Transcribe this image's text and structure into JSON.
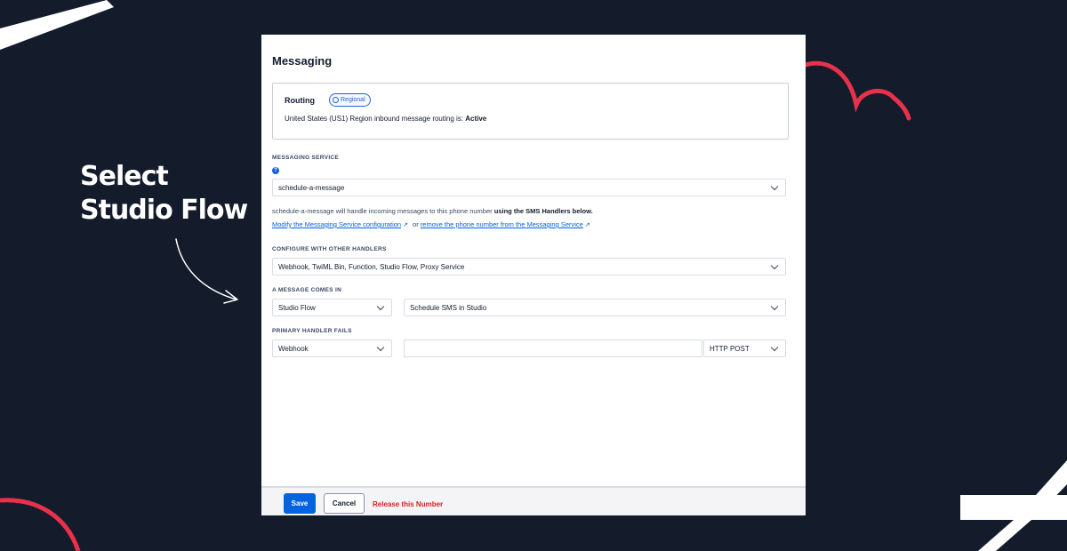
{
  "callout": {
    "line1": "Select",
    "line2": "Studio Flow"
  },
  "panel": {
    "title": "Messaging",
    "routing": {
      "label": "Routing",
      "badge": "Regional",
      "text_prefix": "United States (US1) Region inbound message routing is: ",
      "status": "Active"
    },
    "messaging_service": {
      "label": "MESSAGING SERVICE",
      "selected": "schedule-a-message",
      "info_prefix": "schedule-a-message will handle incoming messages to this phone number ",
      "info_bold": "using the SMS Handlers below.",
      "link_modify": "Modify the Messaging Service configuration",
      "or_text": "or",
      "link_remove": "remove the phone number from the Messaging Service"
    },
    "other_handlers": {
      "label": "CONFIGURE WITH OTHER HANDLERS",
      "selected": "Webhook, TwiML Bin, Function, Studio Flow, Proxy Service"
    },
    "message_comes_in": {
      "label": "A MESSAGE COMES IN",
      "type_selected": "Studio Flow",
      "flow_selected": "Schedule SMS in Studio"
    },
    "primary_handler_fails": {
      "label": "PRIMARY HANDLER FAILS",
      "type_selected": "Webhook",
      "url_value": "",
      "method_selected": "HTTP POST"
    },
    "footer": {
      "save": "Save",
      "cancel": "Cancel",
      "release": "Release this Number"
    }
  },
  "colors": {
    "background": "#141b2b",
    "accent_red": "#e8314a",
    "primary_blue": "#0263e0",
    "danger_red": "#d61f1f"
  }
}
